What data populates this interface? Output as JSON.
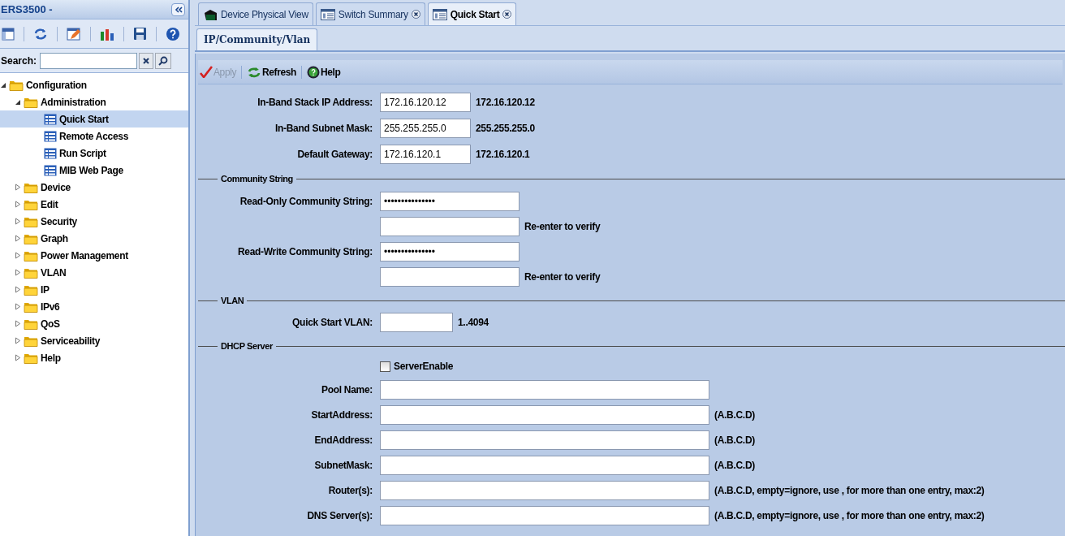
{
  "sidebar": {
    "title": "ERS3500 -",
    "search": {
      "label": "Search:"
    },
    "tree": [
      {
        "label": "Configuration",
        "kind": "folder",
        "expanded": true,
        "selected": false,
        "children": [
          {
            "label": "Administration",
            "kind": "folder",
            "expanded": true,
            "selected": false,
            "children": [
              {
                "label": "Quick Start",
                "kind": "page",
                "selected": true
              },
              {
                "label": "Remote Access",
                "kind": "page",
                "selected": false
              },
              {
                "label": "Run Script",
                "kind": "page",
                "selected": false
              },
              {
                "label": "MIB Web Page",
                "kind": "page",
                "selected": false
              }
            ]
          },
          {
            "label": "Device",
            "kind": "folder",
            "expanded": false,
            "selected": false
          },
          {
            "label": "Edit",
            "kind": "folder",
            "expanded": false,
            "selected": false
          },
          {
            "label": "Security",
            "kind": "folder",
            "expanded": false,
            "selected": false
          },
          {
            "label": "Graph",
            "kind": "folder",
            "expanded": false,
            "selected": false
          },
          {
            "label": "Power Management",
            "kind": "folder",
            "expanded": false,
            "selected": false
          },
          {
            "label": "VLAN",
            "kind": "folder",
            "expanded": false,
            "selected": false
          },
          {
            "label": "IP",
            "kind": "folder",
            "expanded": false,
            "selected": false
          },
          {
            "label": "IPv6",
            "kind": "folder",
            "expanded": false,
            "selected": false
          },
          {
            "label": "QoS",
            "kind": "folder",
            "expanded": false,
            "selected": false
          },
          {
            "label": "Serviceability",
            "kind": "folder",
            "expanded": false,
            "selected": false
          },
          {
            "label": "Help",
            "kind": "folder",
            "expanded": false,
            "selected": false
          }
        ]
      }
    ]
  },
  "tabs": [
    {
      "label": "Device Physical View",
      "kind": "device",
      "selected": false,
      "closable": false
    },
    {
      "label": "Switch Summary",
      "kind": "page",
      "selected": false,
      "closable": true
    },
    {
      "label": "Quick Start",
      "kind": "page",
      "selected": true,
      "closable": true
    }
  ],
  "subtabs": [
    {
      "label": "IP/Community/Vlan",
      "selected": true
    }
  ],
  "toolbar": [
    {
      "label": "Apply",
      "kind": "apply",
      "disabled": true
    },
    {
      "label": "Refresh",
      "kind": "refresh",
      "disabled": false
    },
    {
      "label": "Help",
      "kind": "help",
      "disabled": false
    }
  ],
  "sections": [
    {
      "rows": [
        {
          "kind": "ip",
          "label": "In-Band Stack IP Address:",
          "value": "172.16.120.12",
          "note": "172.16.120.12"
        },
        {
          "kind": "ip",
          "label": "In-Band Subnet Mask:",
          "value": "255.255.255.0",
          "note": "255.255.255.0"
        },
        {
          "kind": "ip",
          "label": "Default Gateway:",
          "value": "172.16.120.1",
          "note": "172.16.120.1"
        }
      ]
    },
    {
      "title": "Community String",
      "rows": [
        {
          "kind": "password",
          "label": "Read-Only Community String:",
          "value": "•••••••••••••••"
        },
        {
          "kind": "password",
          "note": "Re-enter to verify"
        },
        {
          "kind": "password",
          "label": "Read-Write Community String:",
          "value": "•••••••••••••••"
        },
        {
          "kind": "password",
          "note": "Re-enter to verify"
        }
      ]
    },
    {
      "title": "VLAN",
      "rows": [
        {
          "kind": "vlan",
          "label": "Quick Start VLAN:",
          "note": "1..4094"
        }
      ]
    },
    {
      "title": "DHCP Server",
      "rows": [
        {
          "kind": "checkbox",
          "label": "ServerEnable",
          "checked": false
        },
        {
          "kind": "address",
          "label": "Pool Name:"
        },
        {
          "kind": "address",
          "label": "StartAddress:",
          "note": "(A.B.C.D)"
        },
        {
          "kind": "address",
          "label": "EndAddress:",
          "note": "(A.B.C.D)"
        },
        {
          "kind": "address",
          "label": "SubnetMask:",
          "note": "(A.B.C.D)"
        },
        {
          "kind": "address",
          "label": "Router(s):",
          "note": "(A.B.C.D, empty=ignore, use , for more than one entry, max:2)"
        },
        {
          "kind": "address",
          "label": "DNS Server(s):",
          "note": "(A.B.C.D, empty=ignore, use , for more than one entry, max:2)"
        }
      ]
    }
  ]
}
